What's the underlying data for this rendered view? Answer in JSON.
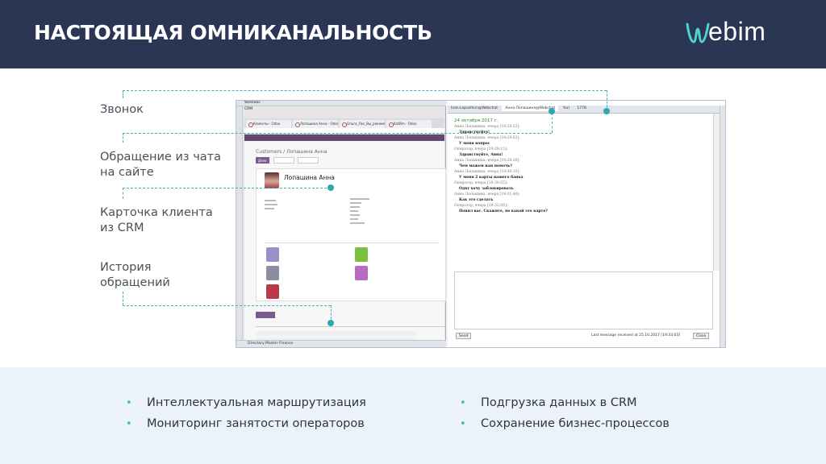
{
  "header": {
    "title": "НАСТОЯЩАЯ ОМНИКАНАЛЬНОСТЬ",
    "logo_text": "ebim",
    "brand_color": "#2b3654",
    "accent_color": "#3bb5ba"
  },
  "labels": [
    {
      "lines": [
        "Звонок"
      ]
    },
    {
      "lines": [
        "Обращение из чата",
        "на сайте"
      ]
    },
    {
      "lines": [
        "Карточка клиента",
        "из CRM"
      ]
    },
    {
      "lines": [
        "История",
        "обращений"
      ]
    }
  ],
  "screenshot": {
    "crm": {
      "window_tab": "Webtabs",
      "window_title": "CRM",
      "browser_tabs": [
        "Клиенты - Odoo",
        "Лопашина Анна - Odoo",
        "Ольга_Лос_Вы_рекомендуем",
        "KaWim - Odoo"
      ],
      "breadcrumb": "Customers / Лопашина Анна",
      "action_button": "Дело",
      "card_name": "Лопашина Анна",
      "footer": "Directory   Master   Finance"
    },
    "chat": {
      "tabs": [
        "Ivan.Lopushkin@Webchat",
        "Анна.Лопашина@Webchat",
        "Yuri",
        "1778"
      ],
      "date": "24 октября 2017 г.",
      "messages": [
        {
          "who": "Анна Лопашина, вчера [19:28:52]:",
          "text": "Здравствуйте!"
        },
        {
          "who": "Анна Лопашина, вчера [19:29:02]:",
          "text": "У меня вопрос"
        },
        {
          "who": "Оператор, вчера [19:29:15]:",
          "text": "Здравствуйте, Анна!"
        },
        {
          "who": "Анна Лопашина, вчера [19:29:30]:",
          "text": "Чем можем вам помочь?"
        },
        {
          "who": "Анна Лопашина, вчера [19:30:10]:",
          "text": "У меня 2 карты вашего банка"
        },
        {
          "who": "Оператор, вчера [19:30:55]:",
          "text": "Одну хочу заблокировать"
        },
        {
          "who": "Анна Лопашина, вчера [19:31:40]:",
          "text": "Как это сделать"
        },
        {
          "who": "Оператор, вчера [19:32:09]:",
          "text": "Понял вас. Скажите, по какой это карте?"
        }
      ],
      "send_button": "Send",
      "footer_note": "Last message received at 25.10.2017 [19:33:03]",
      "close_button": "Close"
    }
  },
  "bullets": {
    "left": [
      "Интеллектуальная маршрутизация",
      "Мониторинг занятости операторов"
    ],
    "right": [
      "Подгрузка данных в CRM",
      "Сохранение бизнес-процессов"
    ]
  }
}
